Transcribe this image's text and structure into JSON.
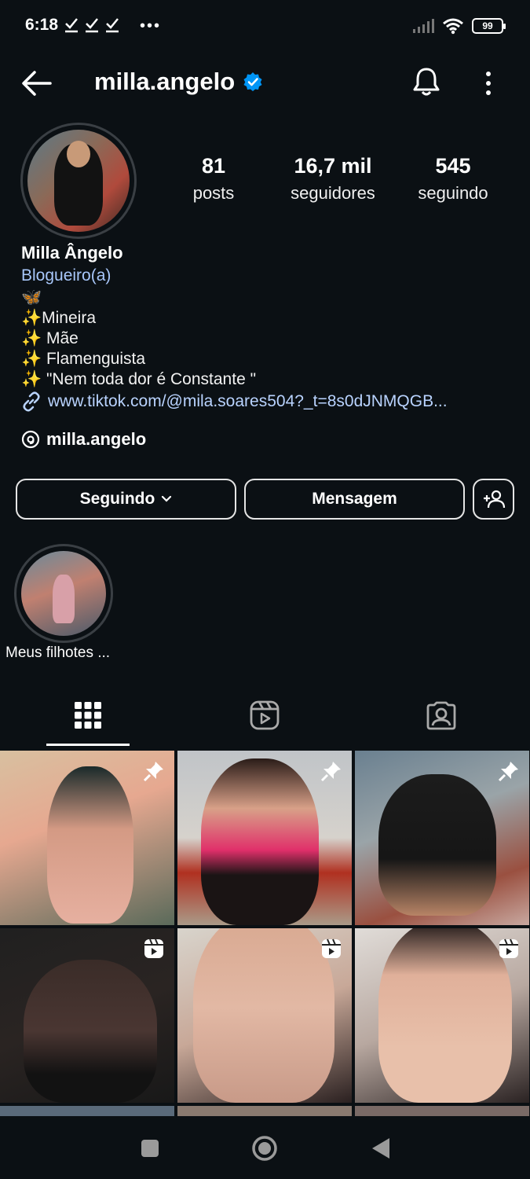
{
  "status_bar": {
    "time": "6:18",
    "battery": "99"
  },
  "header": {
    "username": "milla.angelo",
    "verified": true
  },
  "stats": {
    "posts_count": "81",
    "posts_label": "posts",
    "followers_count": "16,7 mil",
    "followers_label": "seguidores",
    "following_count": "545",
    "following_label": "seguindo"
  },
  "bio": {
    "name": "Milla Ângelo",
    "category": "Blogueiro(a)",
    "lines": [
      "🦋",
      "✨Mineira",
      "✨ Mãe",
      "✨ Flamenguista",
      "✨ \"Nem toda dor é Constante \""
    ],
    "link": "www.tiktok.com/@mila.soares504?_t=8s0dJNMQGB...",
    "threads_handle": "milla.angelo"
  },
  "actions": {
    "following_button": "Seguindo",
    "message_button": "Mensagem"
  },
  "highlights": [
    {
      "label": "Meus filhotes ..."
    }
  ],
  "tabs": [
    "grid-icon",
    "reels-icon",
    "tagged-icon"
  ],
  "posts": [
    {
      "type": "pinned"
    },
    {
      "type": "pinned"
    },
    {
      "type": "pinned"
    },
    {
      "type": "reel"
    },
    {
      "type": "reel"
    },
    {
      "type": "reel"
    }
  ],
  "colors": {
    "background": "#0b1014",
    "link": "#a8c7fa",
    "verified": "#0095f6"
  },
  "icons": [
    "back-arrow-icon",
    "verified-badge-icon",
    "bell-icon",
    "more-vertical-icon",
    "link-icon",
    "threads-icon",
    "chevron-down-icon",
    "add-person-icon",
    "pin-icon",
    "reel-icon"
  ]
}
